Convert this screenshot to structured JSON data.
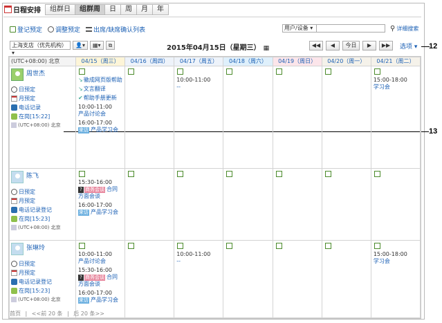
{
  "app": {
    "title": "日程安排"
  },
  "view_tabs": [
    "组群日",
    "组群周",
    "日",
    "周",
    "月",
    "年"
  ],
  "active_tab": "组群周",
  "actions": {
    "register": "登记预定",
    "adjust": "调整预定",
    "attendance": "出席/缺席确认列表"
  },
  "search": {
    "scope": "用户/设备",
    "detail": "详细搜索"
  },
  "filter": {
    "org": "上海支店（优先机构）"
  },
  "date_title": "2015年04月15日（星期三）",
  "nav": {
    "today": "今日",
    "options": "选项",
    "first": "◀◀",
    "prev": "◀",
    "next": "▶",
    "last": "▶▶"
  },
  "callouts": {
    "c12": "12",
    "c13": "13"
  },
  "header": {
    "tz": "(UTC+08:00) 北京",
    "days": [
      "04/15（周三）",
      "04/16（周四）",
      "04/17（周五）",
      "04/18（周六）",
      "04/19（周日）",
      "04/20（周一）",
      "04/21（周二）"
    ]
  },
  "users": [
    {
      "name": "周世杰",
      "links": [
        "日预定",
        "月预定",
        "电话记录",
        "在岗[15:22]"
      ],
      "tz": "(UTC+08:00) 北京",
      "days": [
        [
          {
            "n": "徽成网页版帮助",
            "chk": "↘"
          },
          {
            "n": "文言翻译",
            "chk": "↘"
          },
          {
            "n": "帮助手册更新",
            "chk": "✔"
          },
          {
            "t": "10:00-11:00",
            "n": "产品讨论会"
          },
          {
            "t": "16:00-17:00",
            "tag": "来访",
            "n": "产品学习会"
          }
        ],
        [],
        [
          {
            "t": "10:00-11:00",
            "n": "--"
          }
        ],
        [],
        [],
        [],
        [
          {
            "t": "15:00-18:00",
            "n": "学习会"
          }
        ]
      ]
    },
    {
      "name": "陈飞",
      "links": [
        "日预定",
        "月预定",
        "电话记录登记",
        "在岗[15:23]"
      ],
      "tz": "(UTC+08:00) 北京",
      "days": [
        [
          {
            "t": "15:30-16:00",
            "tag": "商务会谈",
            "q": "?",
            "n": "合同方面会谈"
          },
          {
            "t": "16:00-17:00",
            "tag": "来访",
            "n": "产品学习会"
          }
        ],
        [],
        [],
        [],
        [],
        [],
        []
      ]
    },
    {
      "name": "张琳玲",
      "links": [
        "日预定",
        "月预定",
        "电话记录登记",
        "在岗[15:23]"
      ],
      "tz": "(UTC+08:00) 北京",
      "days": [
        [
          {
            "t": "10:00-11:00",
            "n": "产品讨论会"
          },
          {
            "t": "15:30-16:00",
            "tag": "商务会谈",
            "q": "?",
            "n": "合同方面会谈"
          },
          {
            "t": "16:00-17:00",
            "tag": "来访",
            "n": "产品学习会"
          }
        ],
        [],
        [
          {
            "t": "10:00-11:00",
            "n": "--"
          }
        ],
        [],
        [],
        [],
        [
          {
            "t": "15:00-18:00",
            "n": "学习会"
          }
        ]
      ]
    }
  ],
  "pager": {
    "first": "首页",
    "prev": "<<前 20 条",
    "next": "后 20 条>>",
    "sep": "|"
  }
}
